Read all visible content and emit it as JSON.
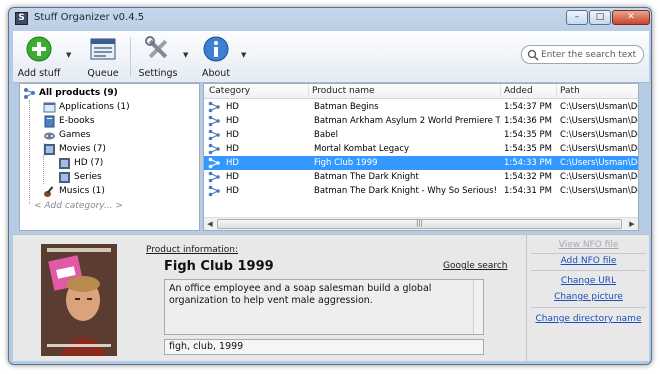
{
  "window": {
    "title": "Stuff Organizer v0.4.5"
  },
  "toolbar": {
    "add_stuff": "Add stuff",
    "queue": "Queue",
    "settings": "Settings",
    "about": "About"
  },
  "search": {
    "placeholder": "Enter the search text"
  },
  "tree": {
    "items": [
      {
        "label": "All products (9)",
        "icon": "network-icon"
      },
      {
        "label": "Applications (1)",
        "icon": "application-icon"
      },
      {
        "label": "E-books",
        "icon": "book-icon"
      },
      {
        "label": "Games",
        "icon": "gamepad-icon"
      },
      {
        "label": "Movies (7)",
        "icon": "film-icon"
      },
      {
        "label": "HD (7)",
        "icon": "film-icon"
      },
      {
        "label": "Series",
        "icon": "film-icon"
      },
      {
        "label": "Musics (1)",
        "icon": "guitar-icon"
      },
      {
        "label": "< Add category... >",
        "icon": ""
      }
    ]
  },
  "list": {
    "columns": [
      "Category",
      "Product name",
      "Added",
      "Path"
    ],
    "rows": [
      {
        "category": "HD",
        "name": "Batman Begins",
        "added": "1:54:37 PM",
        "path": "C:\\Users\\Usman\\De..."
      },
      {
        "category": "HD",
        "name": "Batman Arkham Asylum 2 World Premiere T...",
        "added": "1:54:36 PM",
        "path": "C:\\Users\\Usman\\De..."
      },
      {
        "category": "HD",
        "name": "Babel",
        "added": "1:54:35 PM",
        "path": "C:\\Users\\Usman\\De..."
      },
      {
        "category": "HD",
        "name": "Mortal Kombat Legacy",
        "added": "1:54:35 PM",
        "path": "C:\\Users\\Usman\\De..."
      },
      {
        "category": "HD",
        "name": "Figh Club 1999",
        "added": "1:54:33 PM",
        "path": "C:\\Users\\Usman\\De..."
      },
      {
        "category": "HD",
        "name": "Batman The Dark Knight",
        "added": "1:54:32 PM",
        "path": "C:\\Users\\Usman\\De..."
      },
      {
        "category": "HD",
        "name": "Batman The Dark Knight - Why So Serious!",
        "added": "1:54:31 PM",
        "path": "C:\\Users\\Usman\\De..."
      }
    ],
    "selected_index": 4
  },
  "detail": {
    "info_label": "Product information:",
    "title": "Figh Club 1999",
    "google_search": "Google search",
    "description": "An office employee and a soap salesman build a global organization to help vent male aggression.",
    "tags": "figh, club, 1999"
  },
  "links": {
    "view_nfo": "View NFO file",
    "add_nfo": "Add NFO file",
    "change_url": "Change URL",
    "change_picture": "Change picture",
    "change_dir": "Change directory name"
  },
  "colors": {
    "selection": "#3399ff",
    "link": "#1b4fbf",
    "window_frame": "#b5cae3"
  }
}
